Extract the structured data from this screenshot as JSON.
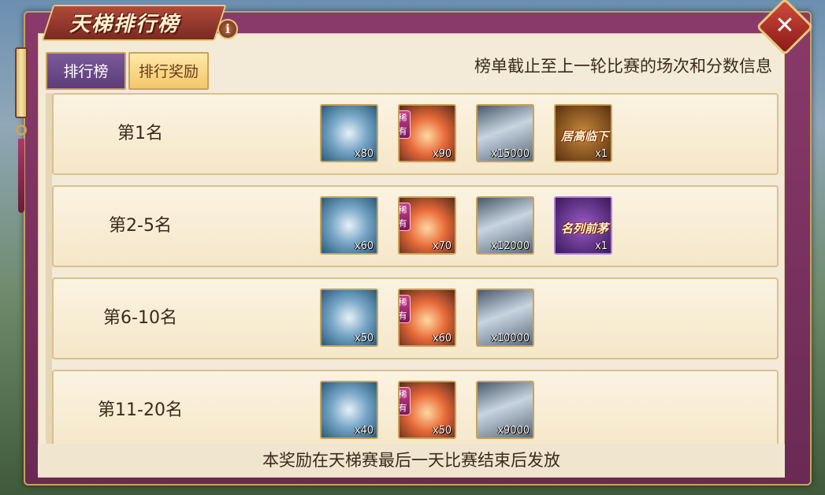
{
  "header": {
    "title": "天梯排行榜",
    "info_label": "i",
    "close_label": "✕"
  },
  "tabs": [
    {
      "label": "排行榜",
      "active": false
    },
    {
      "label": "排行奖励",
      "active": true
    }
  ],
  "notice": "榜单截止至上一轮比赛的场次和分数信息",
  "rows": [
    {
      "label": "第1名",
      "items": [
        {
          "icon": "tree-icon",
          "count": "x80"
        },
        {
          "icon": "fire-icon",
          "count": "x90",
          "rare": "稀有"
        },
        {
          "icon": "card-icon",
          "count": "x15000"
        },
        {
          "icon": "title-badge-icon",
          "count": "x1",
          "text": "居高临下"
        }
      ]
    },
    {
      "label": "第2-5名",
      "items": [
        {
          "icon": "tree-icon",
          "count": "x60"
        },
        {
          "icon": "fire-icon",
          "count": "x70",
          "rare": "稀有"
        },
        {
          "icon": "card-icon",
          "count": "x12000"
        },
        {
          "icon": "title-badge-icon",
          "count": "x1",
          "text": "名列前茅"
        }
      ]
    },
    {
      "label": "第6-10名",
      "items": [
        {
          "icon": "tree-icon",
          "count": "x50"
        },
        {
          "icon": "fire-icon",
          "count": "x60",
          "rare": "稀有"
        },
        {
          "icon": "card-icon",
          "count": "x10000"
        }
      ]
    },
    {
      "label": "第11-20名",
      "items": [
        {
          "icon": "tree-icon",
          "count": "x40"
        },
        {
          "icon": "fire-icon",
          "count": "x50",
          "rare": "稀有"
        },
        {
          "icon": "card-icon",
          "count": "x9000"
        }
      ]
    }
  ],
  "footer": "本奖励在天梯赛最后一天比赛结束后发放"
}
